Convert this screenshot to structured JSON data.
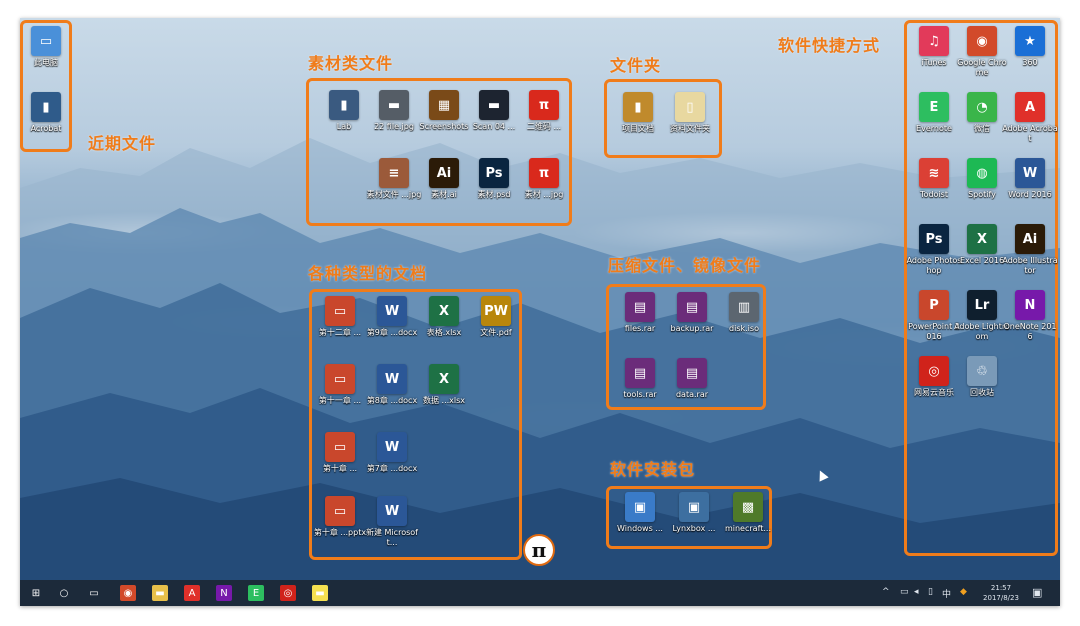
{
  "annotations": {
    "recent_files": "近期文件",
    "material_files": "素材类文件",
    "folders": "文件夹",
    "todo_docs": "各种类型的文档",
    "archives": "压缩文件、镜像文件",
    "installers": "软件安装包",
    "shortcuts": "软件快捷方式"
  },
  "desktop_icons": {
    "recent": [
      {
        "label": "此电脑",
        "icon": "computer-icon",
        "glyph": "▭",
        "color": "#4a90d9"
      },
      {
        "label": "Acrobat",
        "icon": "document-icon",
        "glyph": "▮",
        "color": "#2f5b8a"
      }
    ],
    "material": [
      {
        "label": "Lab",
        "icon": "photo-file-icon",
        "glyph": "▮",
        "color": "#3a5a80"
      },
      {
        "label": "22 file.jpg",
        "icon": "image-file-icon",
        "glyph": "▬",
        "color": "#555d66"
      },
      {
        "label": "Screenshots",
        "icon": "grid-image-icon",
        "glyph": "▦",
        "color": "#7a4a18"
      },
      {
        "label": "Scan 04 ...",
        "icon": "dark-image-icon",
        "glyph": "▬",
        "color": "#1d2430"
      },
      {
        "label": "二维码 ...",
        "icon": "pi-file-icon",
        "glyph": "π",
        "color": "#d9291c"
      },
      {
        "label": "素材文件 ...jpg",
        "icon": "striped-doc-icon",
        "glyph": "≡",
        "color": "#9b5a3a"
      },
      {
        "label": "素材.ai",
        "icon": "illustrator-file-icon",
        "glyph": "Ai",
        "color": "#2b1b08"
      },
      {
        "label": "素材.psd",
        "icon": "photoshop-file-icon",
        "glyph": "Ps",
        "color": "#0a2540"
      },
      {
        "label": "素材 ...jpg",
        "icon": "pi-logo-file-icon",
        "glyph": "π",
        "color": "#d9291c"
      }
    ],
    "folders": [
      {
        "label": "项目文档",
        "icon": "folder-icon",
        "glyph": "▮",
        "color": "#c08a2c"
      },
      {
        "label": "资料文件夹",
        "icon": "folder-icon",
        "glyph": "▯",
        "color": "#e8d8a0"
      }
    ],
    "docs": [
      {
        "label": "第十二章 ...",
        "icon": "pptx-file-icon",
        "glyph": "▭",
        "color": "#c9472c"
      },
      {
        "label": "第9章 ...docx",
        "icon": "word-file-icon",
        "glyph": "W",
        "color": "#2b5797"
      },
      {
        "label": "表格.xlsx",
        "icon": "excel-file-icon",
        "glyph": "X",
        "color": "#1e7145"
      },
      {
        "label": "文件.pdf",
        "icon": "pdf-file-icon",
        "glyph": "PW",
        "color": "#b8860b"
      },
      {
        "label": "第十一章 ...",
        "icon": "pptx-file-icon",
        "glyph": "▭",
        "color": "#c9472c"
      },
      {
        "label": "第8章 ...docx",
        "icon": "word-file-icon",
        "glyph": "W",
        "color": "#2b5797"
      },
      {
        "label": "数据 ...xlsx",
        "icon": "excel-file-icon",
        "glyph": "X",
        "color": "#1e7145"
      },
      {
        "label": "第十章 ...",
        "icon": "pptx-file-icon",
        "glyph": "▭",
        "color": "#c9472c"
      },
      {
        "label": "第7章 ...docx",
        "icon": "word-file-icon",
        "glyph": "W",
        "color": "#2b5797"
      },
      {
        "label": "第十章 ...pptx",
        "icon": "pptx-file-icon",
        "glyph": "▭",
        "color": "#c9472c"
      },
      {
        "label": "新建 Microsoft...",
        "icon": "word-file-icon",
        "glyph": "W",
        "color": "#2b5797"
      }
    ],
    "archives": [
      {
        "label": "files.rar",
        "icon": "winrar-archive-icon",
        "glyph": "▤",
        "color": "#6b2c7a"
      },
      {
        "label": "backup.rar",
        "icon": "winrar-archive-icon",
        "glyph": "▤",
        "color": "#6b2c7a"
      },
      {
        "label": "disk.iso",
        "icon": "disc-image-icon",
        "glyph": "▥",
        "color": "#5c6670"
      },
      {
        "label": "tools.rar",
        "icon": "winrar-archive-icon",
        "glyph": "▤",
        "color": "#6b2c7a"
      },
      {
        "label": "data.rar",
        "icon": "winrar-archive-icon",
        "glyph": "▤",
        "color": "#6b2c7a"
      }
    ],
    "installers": [
      {
        "label": "Windows ...",
        "icon": "installer-icon",
        "glyph": "▣",
        "color": "#3a7bc8"
      },
      {
        "label": "Lynxbox ...",
        "icon": "setup-box-icon",
        "glyph": "▣",
        "color": "#3d6fa0"
      },
      {
        "label": "minecraft...",
        "icon": "minecraft-icon",
        "glyph": "▩",
        "color": "#4f7a2a"
      }
    ],
    "apps": [
      {
        "label": "iTunes",
        "icon": "itunes-icon",
        "glyph": "♫",
        "color": "#e23a5a"
      },
      {
        "label": "Google Chrome",
        "icon": "chrome-icon",
        "glyph": "◉",
        "color": "#d24a2a"
      },
      {
        "label": "360",
        "icon": "star-app-icon",
        "glyph": "★",
        "color": "#1a6fd6"
      },
      {
        "label": "Evernote",
        "icon": "evernote-icon",
        "glyph": "E",
        "color": "#2dbe60"
      },
      {
        "label": "微信",
        "icon": "wechat-icon",
        "glyph": "◔",
        "color": "#3ab54a"
      },
      {
        "label": "Adobe Acrobat",
        "icon": "acrobat-icon",
        "glyph": "A",
        "color": "#e0302a"
      },
      {
        "label": "Todoist",
        "icon": "todoist-icon",
        "glyph": "≋",
        "color": "#db4035"
      },
      {
        "label": "Spotify",
        "icon": "spotify-icon",
        "glyph": "◍",
        "color": "#1db954"
      },
      {
        "label": "Word 2016",
        "icon": "word-app-icon",
        "glyph": "W",
        "color": "#2b5797"
      },
      {
        "label": "Adobe Photoshop",
        "icon": "photoshop-app-icon",
        "glyph": "Ps",
        "color": "#0a2540"
      },
      {
        "label": "Excel 2016",
        "icon": "excel-app-icon",
        "glyph": "X",
        "color": "#1e7145"
      },
      {
        "label": "Adobe Illustrator",
        "icon": "illustrator-app-icon",
        "glyph": "Ai",
        "color": "#2b1b08"
      },
      {
        "label": "PowerPoint 2016",
        "icon": "powerpoint-app-icon",
        "glyph": "P",
        "color": "#c9472c"
      },
      {
        "label": "Adobe Lightroom",
        "icon": "lightroom-app-icon",
        "glyph": "Lr",
        "color": "#0f1f2e"
      },
      {
        "label": "OneNote 2016",
        "icon": "onenote-app-icon",
        "glyph": "N",
        "color": "#7719aa"
      },
      {
        "label": "网易云音乐",
        "icon": "netease-music-icon",
        "glyph": "◎",
        "color": "#d0231b"
      },
      {
        "label": "回收站",
        "icon": "recycle-bin-icon",
        "glyph": "♲",
        "color": "#7a9ab8"
      }
    ]
  },
  "taskbar": {
    "items": [
      {
        "icon": "windows-start-icon",
        "glyph": "⊞",
        "color": "transparent"
      },
      {
        "icon": "cortana-search-icon",
        "glyph": "○",
        "color": "transparent"
      },
      {
        "icon": "task-view-icon",
        "glyph": "▭",
        "color": "transparent"
      },
      {
        "icon": "chrome-taskbar-icon",
        "glyph": "◉",
        "color": "#d24a2a"
      },
      {
        "icon": "file-explorer-icon",
        "glyph": "▬",
        "color": "#e8c04a"
      },
      {
        "icon": "acrobat-taskbar-icon",
        "glyph": "A",
        "color": "#e0302a"
      },
      {
        "icon": "onenote-taskbar-icon",
        "glyph": "N",
        "color": "#7719aa"
      },
      {
        "icon": "evernote-taskbar-icon",
        "glyph": "E",
        "color": "#2dbe60"
      },
      {
        "icon": "netease-taskbar-icon",
        "glyph": "◎",
        "color": "#d0231b"
      },
      {
        "icon": "sticky-notes-icon",
        "glyph": "▬",
        "color": "#f5e050"
      }
    ],
    "tray": {
      "chevron": "^",
      "ime": "中",
      "time": "21:57",
      "date": "2017/8/23"
    }
  },
  "pi_logo": "π"
}
